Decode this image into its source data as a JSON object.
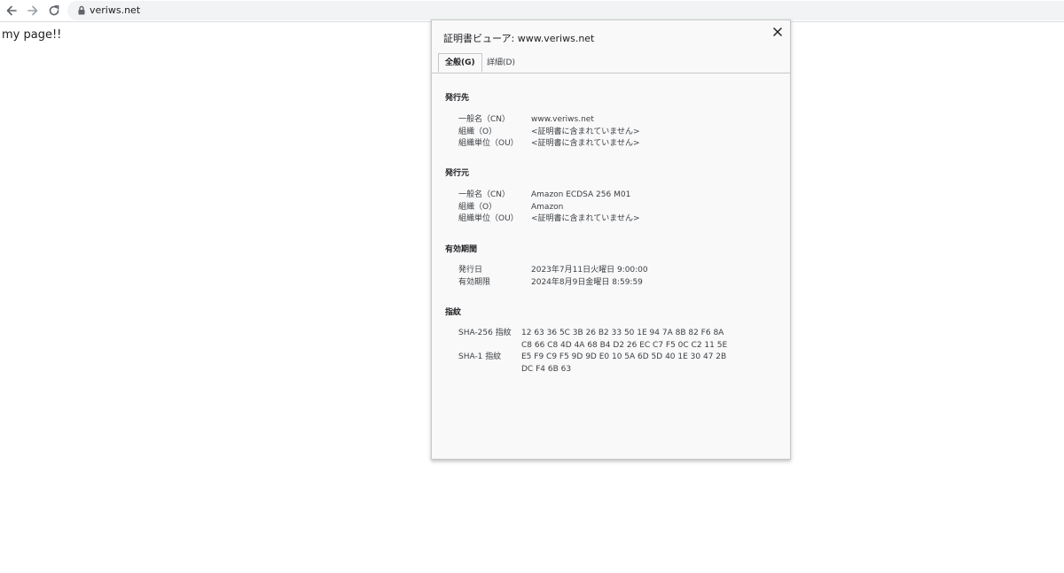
{
  "browser": {
    "url": "veriws.net"
  },
  "page": {
    "text": "my page!!"
  },
  "dialog": {
    "title": "証明書ビューア: www.veriws.net",
    "tabs": [
      {
        "label": "全般(G)",
        "active": true
      },
      {
        "label": "詳細(D)",
        "active": false
      }
    ],
    "issued_to": {
      "header": "発行先",
      "rows": [
        {
          "label": "一般名（CN）",
          "value": "www.veriws.net"
        },
        {
          "label": "組織（O）",
          "value": "<証明書に含まれていません>"
        },
        {
          "label": "組織単位（OU）",
          "value": "<証明書に含まれていません>"
        }
      ]
    },
    "issued_by": {
      "header": "発行元",
      "rows": [
        {
          "label": "一般名（CN）",
          "value": "Amazon ECDSA 256 M01"
        },
        {
          "label": "組織（O）",
          "value": "Amazon"
        },
        {
          "label": "組織単位（OU）",
          "value": "<証明書に含まれていません>"
        }
      ]
    },
    "validity": {
      "header": "有効期間",
      "rows": [
        {
          "label": "発行日",
          "value": "2023年7月11日火曜日 9:00:00"
        },
        {
          "label": "有効期限",
          "value": "2024年8月9日金曜日 8:59:59"
        }
      ]
    },
    "fingerprints": {
      "header": "指紋",
      "rows": [
        {
          "label": "SHA-256 指紋",
          "value": "12 63 36 5C 3B 26 B2 33 50 1E 94 7A 8B 82 F6 8A"
        },
        {
          "label": "",
          "value": "C8 66 C8 4D 4A 68 B4 D2 26 EC C7 F5 0C C2 11 5E"
        },
        {
          "label": "SHA-1 指紋",
          "value": "E5 F9 C9 F5 9D 9D E0 10 5A 6D 5D 40 1E 30 47 2B"
        },
        {
          "label": "",
          "value": "DC F4 6B 63"
        }
      ]
    }
  }
}
